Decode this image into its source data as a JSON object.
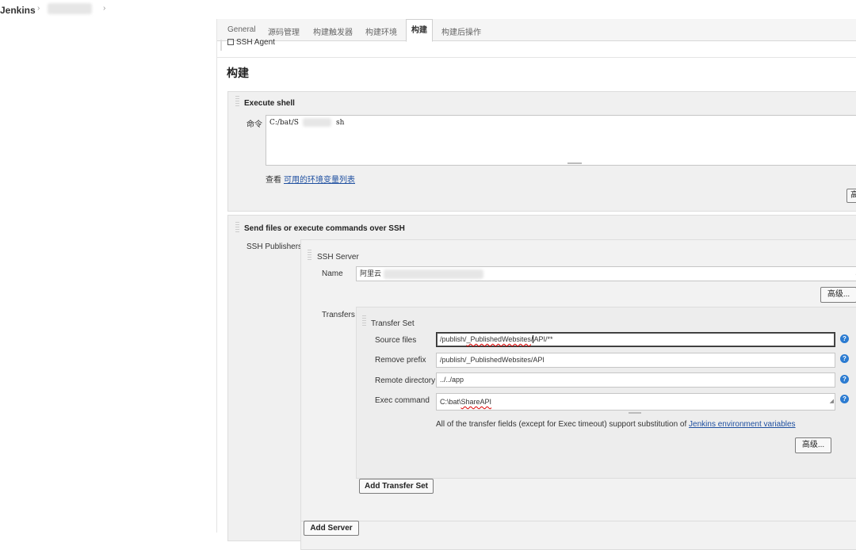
{
  "breadcrumb": {
    "brand": "Jenkins",
    "sep": "›"
  },
  "tabs": [
    {
      "label": "General"
    },
    {
      "label": "源码管理"
    },
    {
      "label": "构建触发器"
    },
    {
      "label": "构建环境"
    },
    {
      "label": "构建"
    },
    {
      "label": "构建后操作"
    }
  ],
  "ssh_agent_label": "SSH Agent",
  "build_section_title": "构建",
  "execute_shell": {
    "title": "Execute shell",
    "command_label": "命令",
    "command_prefix": "C:/bat/S",
    "command_suffix": "sh",
    "view_text": "查看",
    "env_link": "可用的环境变量列表"
  },
  "ssh_publish": {
    "title": "Send files or execute commands over SSH",
    "publishers_label": "SSH Publishers",
    "server_title": "SSH Server",
    "name_label": "Name",
    "name_value": "阿里云",
    "advanced_label": "高级...",
    "transfers_label": "Transfers",
    "transfer_set_title": "Transfer Set",
    "source_files_label": "Source files",
    "source_files_value": {
      "a": "/publish/",
      "b": "_PublishedWebsites",
      "c": "/",
      "d": "API",
      "e": "/**"
    },
    "remove_prefix_label": "Remove prefix",
    "remove_prefix_value": "/publish/_PublishedWebsites/API",
    "remote_dir_label": "Remote directory",
    "remote_dir_value": "../../app",
    "exec_command_label": "Exec command",
    "exec_command_prefix": "C:\\bat\\",
    "exec_command_word": "ShareAPI",
    "note_text": "All of the transfer fields (except for Exec timeout) support substitution of ",
    "note_link": "Jenkins environment variables",
    "add_transfer_set": "Add Transfer Set",
    "add_server": "Add Server"
  },
  "icons": {
    "help": "help-icon",
    "dropdown": "chevron-down-icon",
    "checkbox": "checkbox-icon"
  }
}
